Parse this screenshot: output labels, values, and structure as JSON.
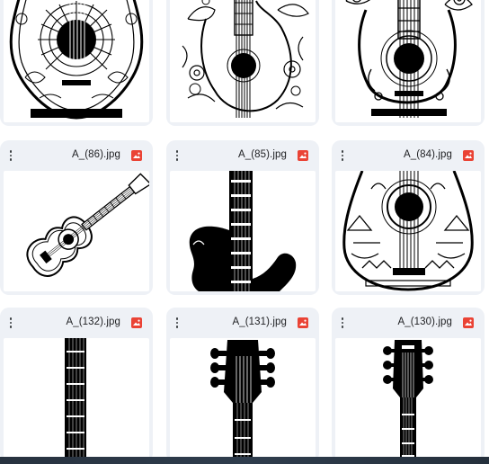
{
  "grid": {
    "rows": [
      {
        "cards": [
          {
            "filename": "",
            "icon": "image-file-icon",
            "thumb": "mandala-sun-guitar"
          },
          {
            "filename": "",
            "icon": "image-file-icon",
            "thumb": "floral-guitar"
          },
          {
            "filename": "",
            "icon": "image-file-icon",
            "thumb": "ornate-floral-guitar"
          }
        ]
      },
      {
        "cards": [
          {
            "filename": "A_(86).jpg",
            "icon": "image-file-icon",
            "thumb": "acoustic-guitar-outline"
          },
          {
            "filename": "A_(85).jpg",
            "icon": "image-file-icon",
            "thumb": "electric-guitar-silhouette"
          },
          {
            "filename": "A_(84).jpg",
            "icon": "image-file-icon",
            "thumb": "tribal-pattern-guitar"
          }
        ]
      },
      {
        "cards": [
          {
            "filename": "A_(132).jpg",
            "icon": "image-file-icon",
            "thumb": "guitar-neck-fretboard"
          },
          {
            "filename": "A_(131).jpg",
            "icon": "image-file-icon",
            "thumb": "guitar-headstock-silhouette"
          },
          {
            "filename": "A_(130).jpg",
            "icon": "image-file-icon",
            "thumb": "guitar-headstock-tuners"
          }
        ]
      }
    ]
  },
  "colors": {
    "card_background": "#eef1f6",
    "image_icon_red": "#ea4335",
    "taskbar": "#2a3543"
  }
}
